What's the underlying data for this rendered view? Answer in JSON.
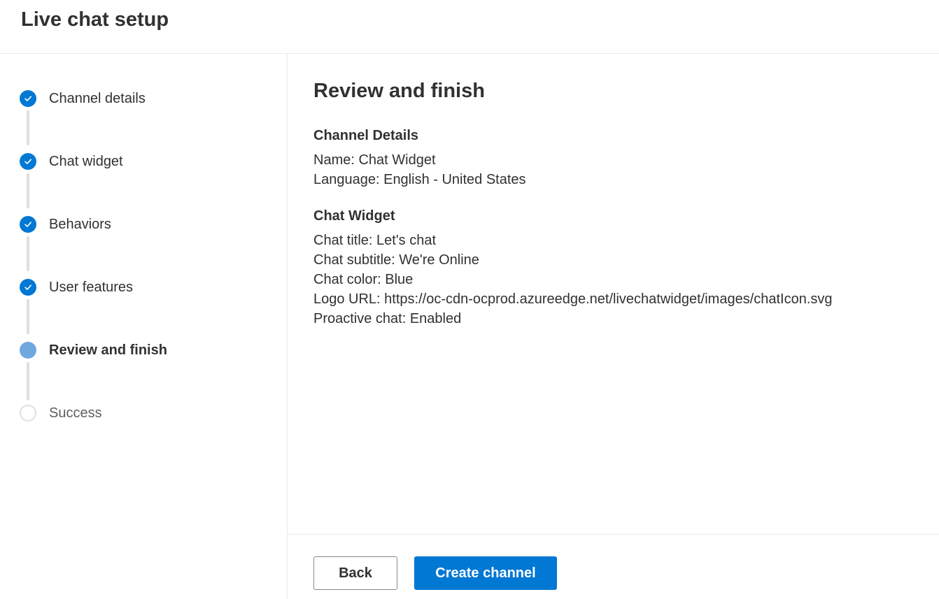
{
  "header": {
    "title": "Live chat setup"
  },
  "steps": [
    {
      "label": "Channel details",
      "status": "done"
    },
    {
      "label": "Chat widget",
      "status": "done"
    },
    {
      "label": "Behaviors",
      "status": "done"
    },
    {
      "label": "User features",
      "status": "done"
    },
    {
      "label": "Review and finish",
      "status": "current"
    },
    {
      "label": "Success",
      "status": "pending"
    }
  ],
  "main": {
    "title": "Review and finish",
    "channel_details": {
      "heading": "Channel Details",
      "name": "Name: Chat Widget",
      "language": "Language: English - United States"
    },
    "chat_widget": {
      "heading": "Chat Widget",
      "title": "Chat title: Let's chat",
      "subtitle": "Chat subtitle: We're Online",
      "color": "Chat color: Blue",
      "logo_url": "Logo URL: https://oc-cdn-ocprod.azureedge.net/livechatwidget/images/chatIcon.svg",
      "proactive": "Proactive chat: Enabled"
    }
  },
  "footer": {
    "back_label": "Back",
    "create_label": "Create channel"
  },
  "icons": {
    "done": "checkmark-icon"
  },
  "colors": {
    "accent": "#0078d4",
    "current_step": "#6ea8de",
    "pending_step_border": "#e1dfdd"
  }
}
